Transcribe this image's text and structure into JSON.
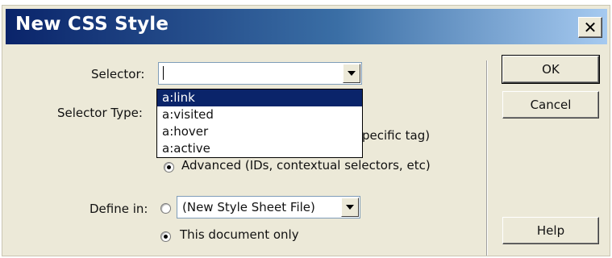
{
  "window": {
    "title": "New CSS Style",
    "close_label": "✕"
  },
  "form": {
    "selector_label": "Selector:",
    "selector_value": "",
    "selector_options": [
      "a:link",
      "a:visited",
      "a:hover",
      "a:active"
    ],
    "selected_option": "a:link",
    "selector_type_label": "Selector Type:",
    "type_tag_text": "pecific tag)",
    "type_advanced_text": "Advanced (IDs, contextual selectors, etc)",
    "define_in_label": "Define in:",
    "stylesheet_value": "(New Style Sheet File)",
    "this_doc_text": "This document only"
  },
  "buttons": {
    "ok": "OK",
    "cancel": "Cancel",
    "help": "Help"
  },
  "colors": {
    "titlebar_start": "#0a246a",
    "titlebar_end": "#a6caf0",
    "dialog_bg": "#ece9d8",
    "highlight": "#0a246a"
  }
}
